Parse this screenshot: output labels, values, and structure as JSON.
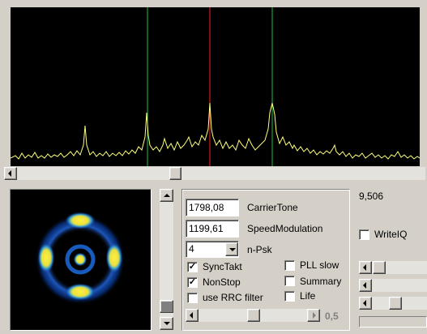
{
  "controls": {
    "carrier_tone": {
      "value": "1798,08",
      "label": "CarrierTone"
    },
    "speed_modulation": {
      "value": "1199,61",
      "label": "SpeedModulation"
    },
    "npsk": {
      "value": "4",
      "label": "n-Psk"
    },
    "level_display": "9,506",
    "slider_value": "0,5"
  },
  "checkboxes": [
    {
      "label": "SyncTakt",
      "checked": true
    },
    {
      "label": "NonStop",
      "checked": true
    },
    {
      "label": "use RRC filter",
      "checked": false
    },
    {
      "label": "PLL slow",
      "checked": false
    },
    {
      "label": "Summary",
      "checked": false
    },
    {
      "label": "Life",
      "checked": false
    },
    {
      "label": "WriteIQ",
      "checked": false
    }
  ],
  "spectrum": {
    "background": "#000000",
    "trace_color": "#ffff80",
    "center_marker_color": "#ff2020",
    "side_marker_color": "#20c040"
  },
  "icons": {
    "scroll_left": "triangle-left-icon",
    "scroll_right": "triangle-right-icon",
    "scroll_up": "triangle-up-icon",
    "scroll_down": "triangle-down-icon",
    "dropdown": "chevron-down-icon"
  }
}
